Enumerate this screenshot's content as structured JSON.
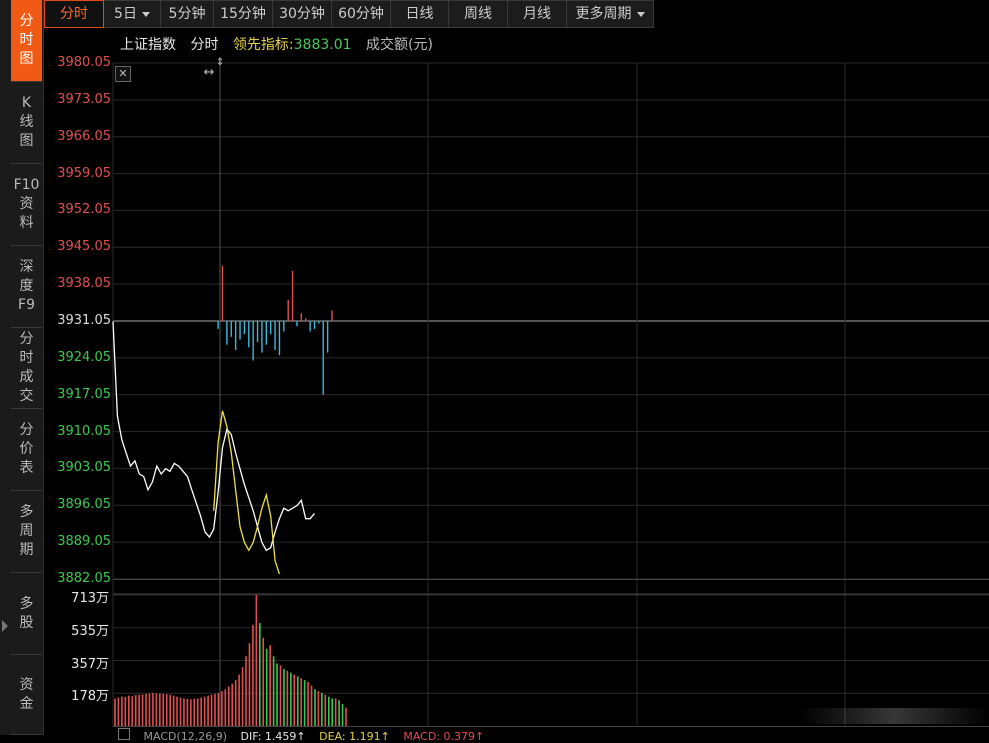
{
  "sidebar": {
    "tabs": [
      {
        "lines": [
          "分",
          "时",
          "图"
        ],
        "active": true
      },
      {
        "lines": [
          "K",
          "线",
          "图"
        ],
        "active": false
      },
      {
        "lines": [
          "F10",
          "资",
          "料"
        ],
        "active": false
      },
      {
        "lines": [
          "深",
          "度",
          "F9"
        ],
        "active": false
      },
      {
        "lines": [
          "分",
          "时",
          "成",
          "交"
        ],
        "active": false
      },
      {
        "lines": [
          "分",
          "价",
          "表"
        ],
        "active": false
      },
      {
        "lines": [
          "多",
          "周",
          "期"
        ],
        "active": false
      },
      {
        "lines": [
          "多",
          "股"
        ],
        "active": false
      },
      {
        "lines": [
          "资",
          "金"
        ],
        "active": false
      }
    ]
  },
  "toolbar": {
    "buttons": [
      {
        "label": "分时",
        "active": true,
        "caret": false
      },
      {
        "label": "5日",
        "active": false,
        "caret": true
      },
      {
        "label": "5分钟",
        "active": false,
        "caret": false
      },
      {
        "label": "15分钟",
        "active": false,
        "caret": false
      },
      {
        "label": "30分钟",
        "active": false,
        "caret": false
      },
      {
        "label": "60分钟",
        "active": false,
        "caret": false
      },
      {
        "label": "日线",
        "active": false,
        "caret": false
      },
      {
        "label": "周线",
        "active": false,
        "caret": false
      },
      {
        "label": "月线",
        "active": false,
        "caret": false
      },
      {
        "label": "更多周期",
        "active": false,
        "caret": true
      }
    ]
  },
  "info": {
    "index_name": "上证指数",
    "mode": "分时",
    "leading_label": "领先指标:",
    "leading_value": "3883.01",
    "volume_label": "成交额(元)"
  },
  "colors": {
    "up": "#e05050",
    "down": "#3cc850",
    "price_line": "#ffffff",
    "leading_line": "#f0e040",
    "active_tab": "#f05a14",
    "bar_down": "#3ab8d8",
    "grid": "#2a2a2a"
  },
  "chart_data": [
    {
      "type": "line",
      "title": "",
      "ylim": [
        3882.05,
        3980.05
      ],
      "yticks": [
        "3980.05",
        "3973.05",
        "3966.05",
        "3959.05",
        "3952.05",
        "3945.05",
        "3938.05",
        "3931.05",
        "3924.05",
        "3917.05",
        "3910.05",
        "3903.05",
        "3896.05",
        "3889.05",
        "3882.05"
      ],
      "reference_price": 3931.05,
      "day_divider_index": 100,
      "series": [
        {
          "role": "price",
          "values": [
            3931.0,
            3913.0,
            3908.5,
            3906.0,
            3903.5,
            3904.5,
            3902.0,
            3901.5,
            3899.0,
            3900.5,
            3903.5,
            3902.0,
            3903.0,
            3902.5,
            3904.0,
            3903.5,
            3902.5,
            3901.5,
            3899.0,
            3896.5,
            3894.0,
            3891.0,
            3890.0,
            3891.5,
            3898.5,
            3907.0,
            3910.5,
            3909.5,
            3906.0,
            3903.0,
            3900.0,
            3897.5,
            3895.0,
            3892.0,
            3889.0,
            3887.5,
            3888.0,
            3891.0,
            3893.5,
            3895.5,
            3895.0,
            3895.5,
            3896.0,
            3897.0,
            3893.5,
            3893.5,
            3894.5
          ],
          "x": [
            0,
            2,
            4,
            6,
            8,
            10,
            12,
            14,
            16,
            18,
            20,
            22,
            24,
            26,
            28,
            30,
            32,
            34,
            36,
            38,
            40,
            42,
            44,
            46,
            48,
            50,
            52,
            54,
            56,
            58,
            60,
            62,
            64,
            66,
            68,
            70,
            72,
            74,
            76,
            78,
            80,
            82,
            84,
            86,
            88,
            90,
            92
          ]
        },
        {
          "role": "leading",
          "values": [
            3895.0,
            3908.0,
            3914.0,
            3911.0,
            3906.0,
            3899.0,
            3892.0,
            3889.0,
            3887.5,
            3889.0,
            3892.0,
            3895.5,
            3898.0,
            3894.0,
            3885.5,
            3883.0
          ],
          "x": [
            46,
            48,
            50,
            52,
            54,
            56,
            58,
            60,
            62,
            64,
            66,
            68,
            70,
            72,
            74,
            76
          ]
        }
      ],
      "deviation_bars": [
        {
          "x": 48,
          "v": -1.5
        },
        {
          "x": 50,
          "v": 10.5
        },
        {
          "x": 52,
          "v": -4.5
        },
        {
          "x": 54,
          "v": -3.0
        },
        {
          "x": 56,
          "v": -5.5
        },
        {
          "x": 58,
          "v": -3.5
        },
        {
          "x": 60,
          "v": -2.5
        },
        {
          "x": 62,
          "v": -5.0
        },
        {
          "x": 64,
          "v": -7.5
        },
        {
          "x": 66,
          "v": -4.0
        },
        {
          "x": 68,
          "v": -6.0
        },
        {
          "x": 70,
          "v": -4.5
        },
        {
          "x": 72,
          "v": -2.5
        },
        {
          "x": 74,
          "v": -5.5
        },
        {
          "x": 76,
          "v": -6.5
        },
        {
          "x": 78,
          "v": -2.0
        },
        {
          "x": 80,
          "v": 4.0
        },
        {
          "x": 82,
          "v": 9.5
        },
        {
          "x": 84,
          "v": -1.0
        },
        {
          "x": 86,
          "v": 1.5
        },
        {
          "x": 88,
          "v": 0.5
        },
        {
          "x": 90,
          "v": -2.0
        },
        {
          "x": 92,
          "v": -1.5
        },
        {
          "x": 94,
          "v": -0.5
        },
        {
          "x": 96,
          "v": -14.0
        },
        {
          "x": 98,
          "v": -6.0
        },
        {
          "x": 100,
          "v": 2.0
        }
      ],
      "xlim": [
        0,
        400
      ]
    },
    {
      "type": "bar",
      "title": "",
      "ylim": [
        0,
        713
      ],
      "yticks": [
        "713万",
        "535万",
        "357万",
        "178万"
      ],
      "x_divider_index": 100,
      "values": [
        150,
        155,
        160,
        158,
        165,
        162,
        168,
        170,
        172,
        175,
        178,
        180,
        178,
        176,
        175,
        174,
        170,
        165,
        160,
        155,
        150,
        148,
        145,
        148,
        150,
        155,
        160,
        165,
        170,
        175,
        180,
        190,
        200,
        215,
        230,
        250,
        280,
        320,
        380,
        450,
        550,
        713,
        560,
        480,
        420,
        440,
        380,
        340,
        330,
        310,
        300,
        290,
        280,
        270,
        260,
        250,
        240,
        220,
        200,
        190,
        180,
        170,
        160,
        150,
        150,
        140,
        120,
        100
      ],
      "colors": [
        "up",
        "up",
        "up",
        "up",
        "up",
        "up",
        "up",
        "up",
        "up",
        "up",
        "up",
        "up",
        "up",
        "up",
        "up",
        "up",
        "up",
        "up",
        "up",
        "up",
        "up",
        "up",
        "up",
        "up",
        "up",
        "up",
        "up",
        "up",
        "up",
        "up",
        "up",
        "up",
        "up",
        "up",
        "up",
        "up",
        "up",
        "up",
        "up",
        "up",
        "up",
        "up",
        "down",
        "up",
        "down",
        "up",
        "down",
        "down",
        "up",
        "down",
        "up",
        "down",
        "up",
        "down",
        "up",
        "down",
        "up",
        "up",
        "down",
        "up",
        "down",
        "up",
        "down",
        "down",
        "up",
        "down",
        "down",
        "up"
      ],
      "xlim": [
        0,
        400
      ]
    }
  ],
  "macd": {
    "name": "MACD(12,26,9)",
    "dif": "DIF: 1.459↑",
    "dea": "DEA: 1.191↑",
    "macd": "MACD: 0.379↑"
  }
}
